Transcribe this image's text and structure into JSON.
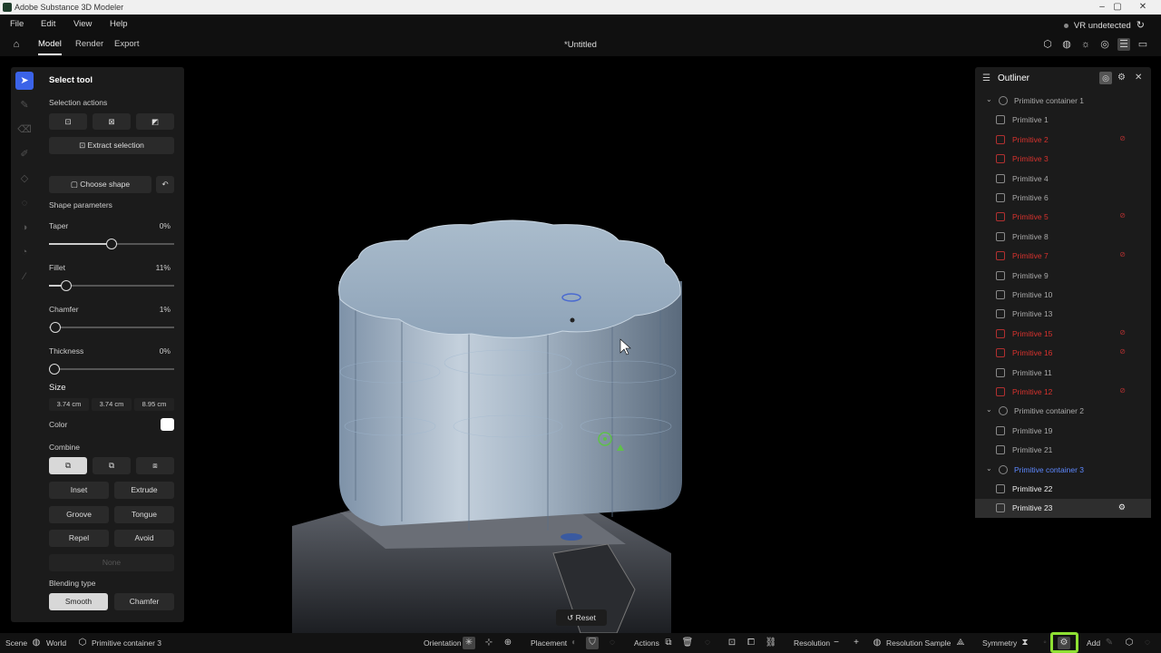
{
  "window": {
    "title": "Adobe Substance 3D Modeler",
    "minimize": "–",
    "maximize": "▢",
    "close": "✕"
  },
  "menu": {
    "items": [
      "File",
      "Edit",
      "View",
      "Help"
    ],
    "vr_status": "VR undetected"
  },
  "tabs": {
    "items": [
      "Model",
      "Render",
      "Export"
    ],
    "active": "Model",
    "document_title": "*Untitled"
  },
  "panel": {
    "header": "Select tool",
    "selection_actions_label": "Selection actions",
    "extract_selection": "Extract selection",
    "choose_shape": "Choose shape",
    "shape_parameters": "Shape parameters",
    "taper": {
      "label": "Taper",
      "value": "0%",
      "level": 0.5
    },
    "fillet": {
      "label": "Fillet",
      "value": "11%",
      "level": 0.11
    },
    "chamfer": {
      "label": "Chamfer",
      "value": "1%",
      "level": 0.01
    },
    "thickness": {
      "label": "Thickness",
      "value": "0%",
      "level": 0
    },
    "size_label": "Size",
    "size": [
      "3.74 cm",
      "3.74 cm",
      "8.95 cm"
    ],
    "color_label": "Color",
    "color_value": "#ffffff",
    "combine_label": "Combine",
    "ops": [
      "Inset",
      "Extrude",
      "Groove",
      "Tongue",
      "Repel",
      "Avoid"
    ],
    "none_label": "None",
    "blending_label": "Blending type",
    "blending": [
      "Smooth",
      "Chamfer"
    ],
    "blending_selected": "Smooth"
  },
  "outliner": {
    "title": "Outliner",
    "rows": [
      {
        "label": "Primitive container 1",
        "kind": "container",
        "style": "grey"
      },
      {
        "label": "Primitive 1",
        "kind": "item",
        "style": "grey"
      },
      {
        "label": "Primitive 2",
        "kind": "item",
        "style": "red",
        "flag": true
      },
      {
        "label": "Primitive 3",
        "kind": "item",
        "style": "red"
      },
      {
        "label": "Primitive 4",
        "kind": "item",
        "style": "grey"
      },
      {
        "label": "Primitive 6",
        "kind": "item",
        "style": "grey"
      },
      {
        "label": "Primitive 5",
        "kind": "item",
        "style": "red",
        "flag": true
      },
      {
        "label": "Primitive 8",
        "kind": "item",
        "style": "grey"
      },
      {
        "label": "Primitive 7",
        "kind": "item",
        "style": "red",
        "flag": true
      },
      {
        "label": "Primitive 9",
        "kind": "item",
        "style": "grey"
      },
      {
        "label": "Primitive 10",
        "kind": "item",
        "style": "grey"
      },
      {
        "label": "Primitive 13",
        "kind": "item",
        "style": "grey"
      },
      {
        "label": "Primitive 15",
        "kind": "item",
        "style": "red",
        "flag": true
      },
      {
        "label": "Primitive 16",
        "kind": "item",
        "style": "red",
        "flag": true
      },
      {
        "label": "Primitive 11",
        "kind": "item",
        "style": "grey"
      },
      {
        "label": "Primitive 12",
        "kind": "item",
        "style": "red",
        "flag": true
      },
      {
        "label": "Primitive container 2",
        "kind": "container",
        "style": "grey"
      },
      {
        "label": "Primitive 19",
        "kind": "item",
        "style": "grey"
      },
      {
        "label": "Primitive 21",
        "kind": "item",
        "style": "grey"
      },
      {
        "label": "Primitive container 3",
        "kind": "container",
        "style": "blue"
      },
      {
        "label": "Primitive 22",
        "kind": "item",
        "style": "white"
      },
      {
        "label": "Primitive 23",
        "kind": "item",
        "style": "white",
        "selected": true
      }
    ]
  },
  "viewport": {
    "reset_label": "Reset"
  },
  "status": {
    "scene": "Scene",
    "world": "World",
    "container": "Primitive container 3",
    "orientation": "Orientation",
    "placement": "Placement",
    "actions": "Actions",
    "resolution": "Resolution",
    "resolution_sample": "Resolution Sample",
    "symmetry": "Symmetry",
    "add": "Add"
  }
}
